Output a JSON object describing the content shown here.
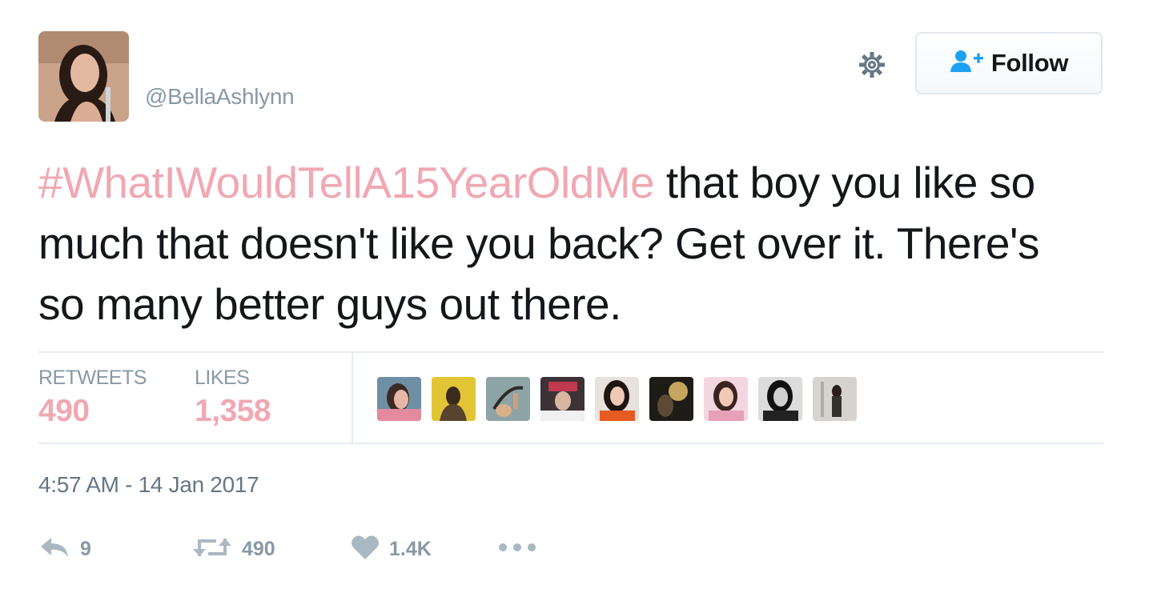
{
  "tweet": {
    "handle": "@BellaAshlynn",
    "text_hashtag": "#WhatIWouldTellA15YearOldMe",
    "text_body": " that boy you like so much that doesn't like you back? Get over it. There's so many better guys out there.",
    "timestamp": "4:57 AM - 14 Jan 2017"
  },
  "header": {
    "follow_label": "Follow",
    "gear_icon": "gear-icon",
    "follow_icon": "add-user-icon"
  },
  "stats": {
    "retweets_label": "RETWEETS",
    "retweets_value": "490",
    "likes_label": "LIKES",
    "likes_value": "1,358"
  },
  "actions": {
    "reply_count": "9",
    "retweet_count": "490",
    "like_count": "1.4K",
    "more_icon": "more-dots-icon"
  },
  "colors": {
    "accent_pink": "#f0a8b2",
    "text": "#14171a",
    "muted": "#8899a6",
    "follow_blue": "#1da1f2"
  }
}
